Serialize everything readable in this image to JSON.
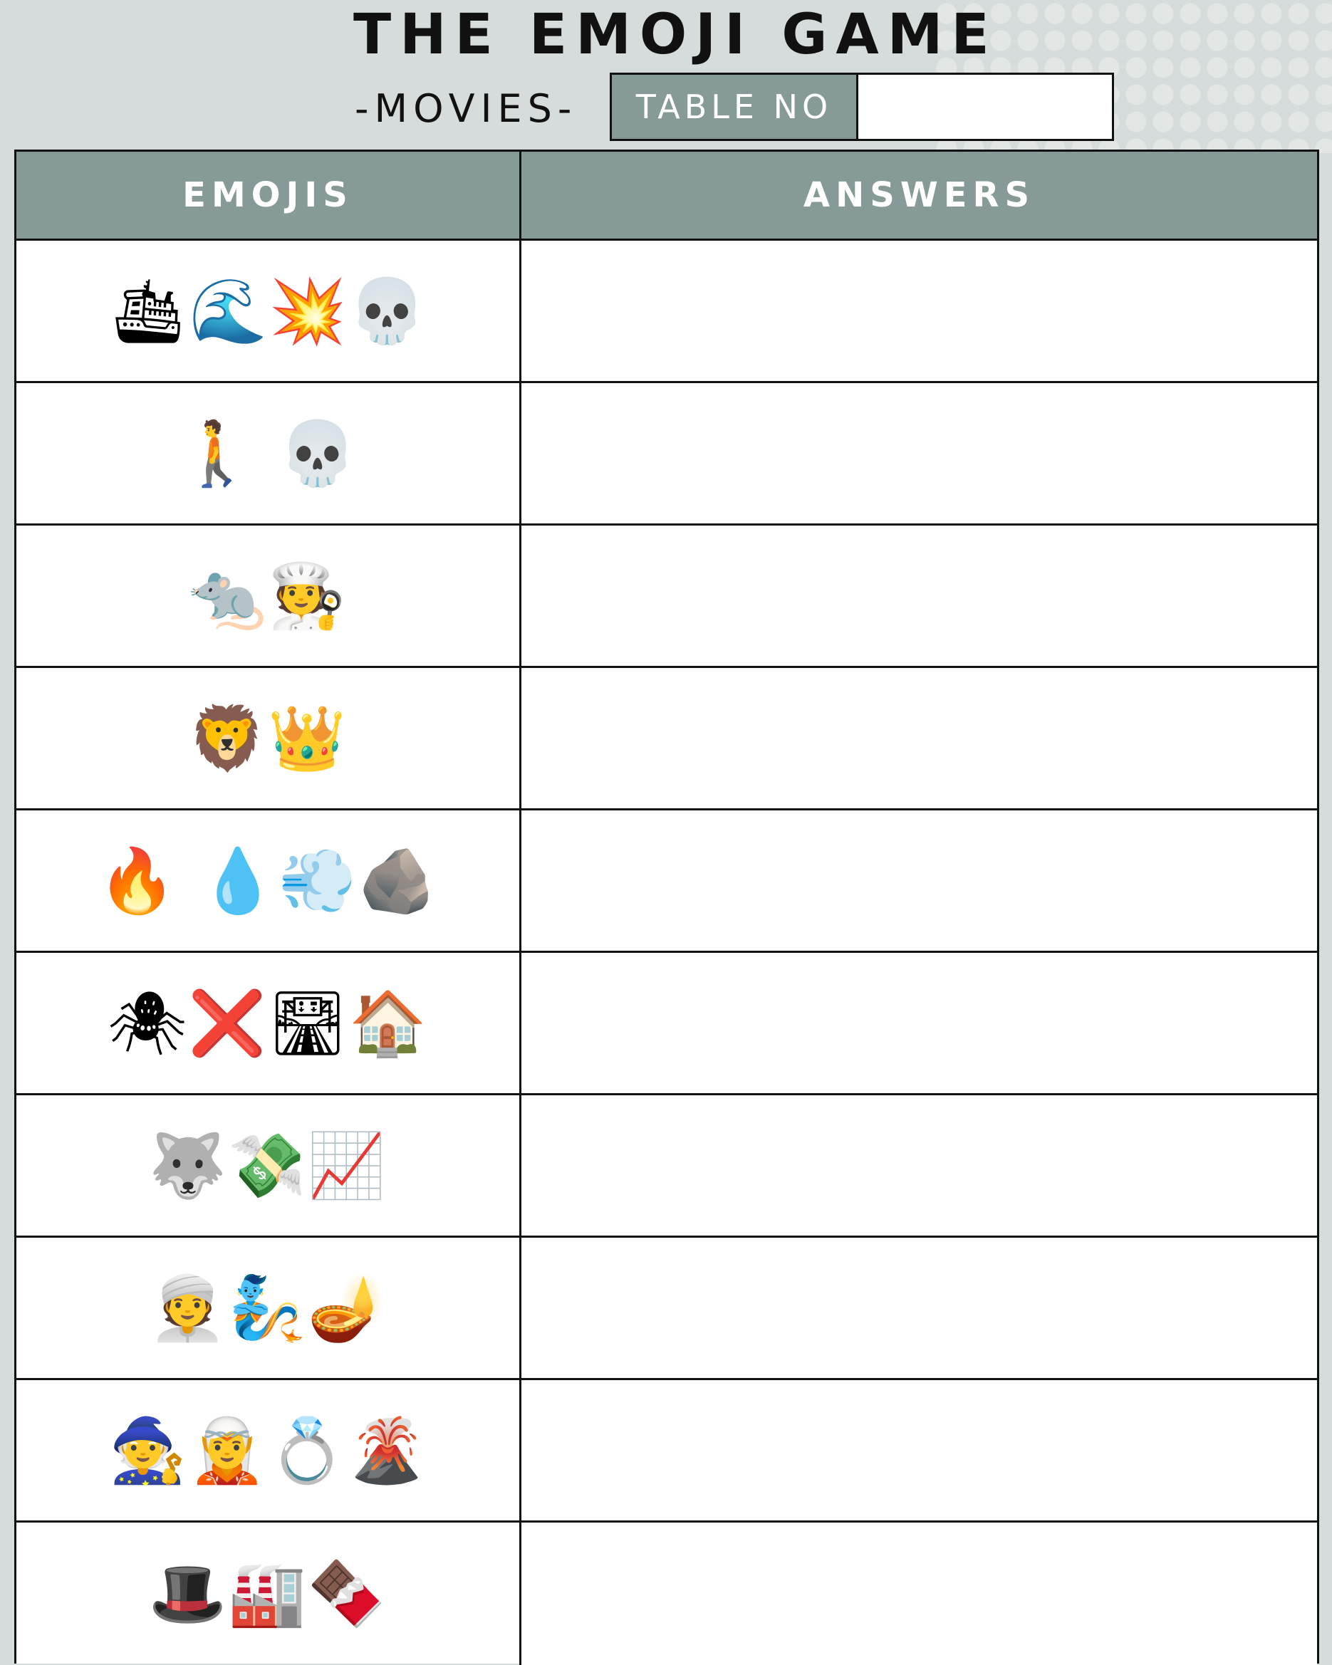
{
  "header": {
    "title": "THE EMOJI GAME",
    "subtitle": "-MOVIES-",
    "table_no_label": "TABLE NO",
    "table_no_value": ""
  },
  "columns": {
    "emojis": "EMOJIS",
    "answers": "ANSWERS"
  },
  "rows": [
    {
      "emojis": "🛳🌊💥💀",
      "answer": ""
    },
    {
      "emojis": "🚶 💀",
      "answer": ""
    },
    {
      "emojis": "🐀🧑‍🍳",
      "answer": ""
    },
    {
      "emojis": "🦁👑",
      "answer": ""
    },
    {
      "emojis": "🔥 💧💨🪨",
      "answer": ""
    },
    {
      "emojis": "🕷❌🛣🏠",
      "answer": ""
    },
    {
      "emojis": "🐺💸📈",
      "answer": ""
    },
    {
      "emojis": "👳🧞🪔",
      "answer": ""
    },
    {
      "emojis": "🧙🧝💍🌋",
      "answer": ""
    },
    {
      "emojis": "🎩🏭🍫",
      "answer": ""
    }
  ],
  "colors": {
    "header_fill": "#869b97",
    "background": "#d5dcdb",
    "border": "#111111"
  }
}
